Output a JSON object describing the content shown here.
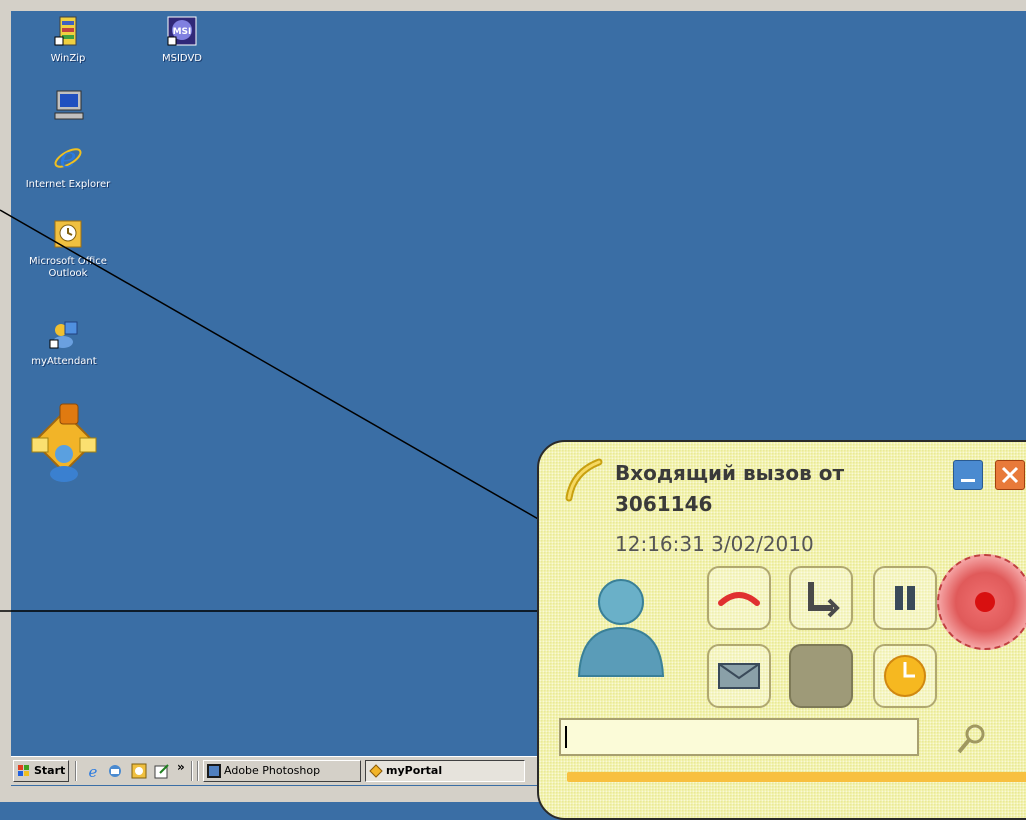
{
  "desktop": {
    "icons": [
      {
        "label": "WinZip",
        "icon": "winzip-icon"
      },
      {
        "label": "MSIDVD",
        "icon": "msi-icon"
      },
      {
        "label": "",
        "icon": "my-computer-icon"
      },
      {
        "label": "Internet Explorer",
        "icon": "internet-explorer-icon"
      },
      {
        "label": "Microsoft Office Outlook",
        "icon": "outlook-icon"
      },
      {
        "label": "myAttendant",
        "icon": "myattendant-icon"
      },
      {
        "label": "",
        "icon": "myportal-large-icon"
      }
    ]
  },
  "taskbar": {
    "start_label": "Start",
    "quick_launch": [
      "internet-explorer-icon",
      "outlook-express-icon",
      "clock-icon",
      "edit-icon"
    ],
    "chevron": "»",
    "tasks": [
      {
        "label": "Adobe Photoshop",
        "active": false
      },
      {
        "label": "myPortal",
        "active": true
      }
    ]
  },
  "popup": {
    "title_line1": "Входящий вызов от",
    "title_line2": "3061146",
    "datetime": "12:16:31 3/02/2010",
    "search_value": "",
    "colors": {
      "background": "#f3f3a8",
      "progress": "#f8c040",
      "record": "#d81010"
    }
  }
}
